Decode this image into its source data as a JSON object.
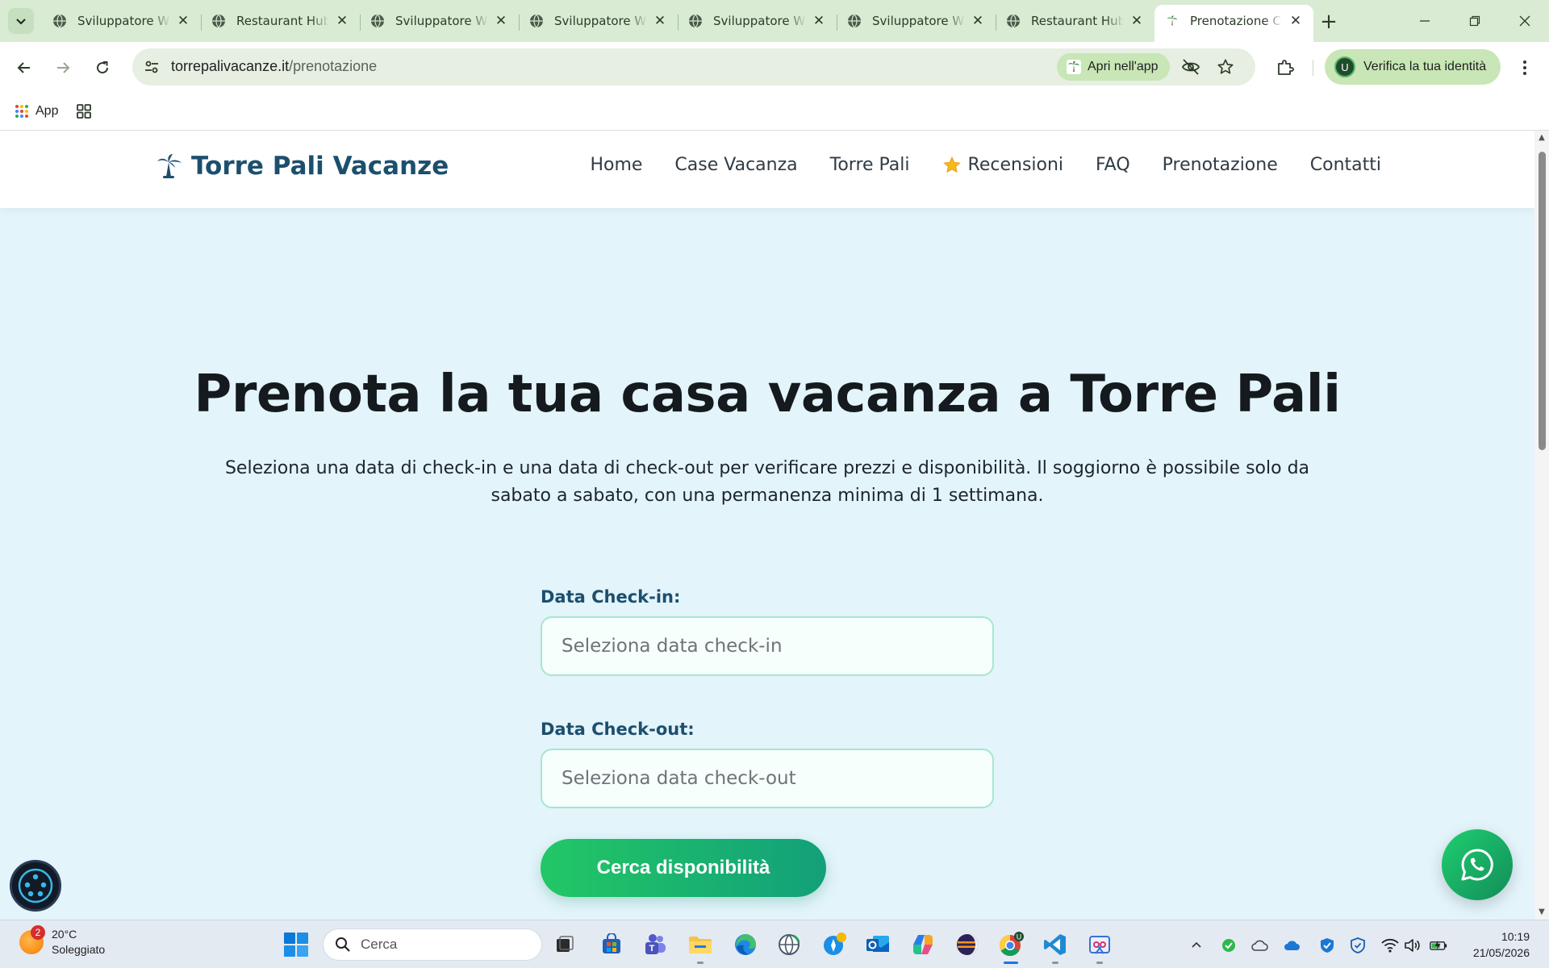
{
  "browser": {
    "tabs": [
      {
        "title": "Sviluppatore W",
        "active": false
      },
      {
        "title": "Restaurant Hub",
        "active": false
      },
      {
        "title": "Sviluppatore W",
        "active": false
      },
      {
        "title": "Sviluppatore W",
        "active": false
      },
      {
        "title": "Sviluppatore W",
        "active": false
      },
      {
        "title": "Sviluppatore W",
        "active": false
      },
      {
        "title": "Restaurant Hub",
        "active": false
      },
      {
        "title": "Prenotazione C",
        "active": true
      }
    ],
    "url_domain": "torrepalivacanze.it",
    "url_path": "/prenotazione",
    "open_in_app_label": "Apri nell'app",
    "identity_label": "Verifica la tua identità",
    "avatar_initial": "U",
    "bookmarks": {
      "apps_label": "App"
    }
  },
  "site": {
    "brand": "Torre Pali Vacanze",
    "nav": [
      {
        "label": "Home"
      },
      {
        "label": "Case Vacanza"
      },
      {
        "label": "Torre Pali"
      },
      {
        "label": "Recensioni",
        "icon": "star-icon"
      },
      {
        "label": "FAQ"
      },
      {
        "label": "Prenotazione"
      },
      {
        "label": "Contatti"
      }
    ]
  },
  "hero": {
    "title": "Prenota la tua casa vacanza a Torre Pali",
    "subtitle": "Seleziona una data di check-in e una data di check-out per verificare prezzi e disponibilità. Il soggiorno è possibile solo da sabato a sabato, con una permanenza minima di 1 settimana."
  },
  "form": {
    "checkin_label": "Data Check-in:",
    "checkin_placeholder": "Seleziona data check-in",
    "checkout_label": "Data Check-out:",
    "checkout_placeholder": "Seleziona data check-out",
    "submit_label": "Cerca disponibilità"
  },
  "taskbar": {
    "weather_temp": "20°C",
    "weather_desc": "Soleggiato",
    "weather_badge": "2",
    "search_label": "Cerca",
    "time": "10:19",
    "date": "21/05/2026"
  },
  "colors": {
    "brand": "#1c4f6e",
    "accent_green": "#22c765",
    "page_bg": "#e3f4fb",
    "chrome_green": "#d9ebd3"
  }
}
